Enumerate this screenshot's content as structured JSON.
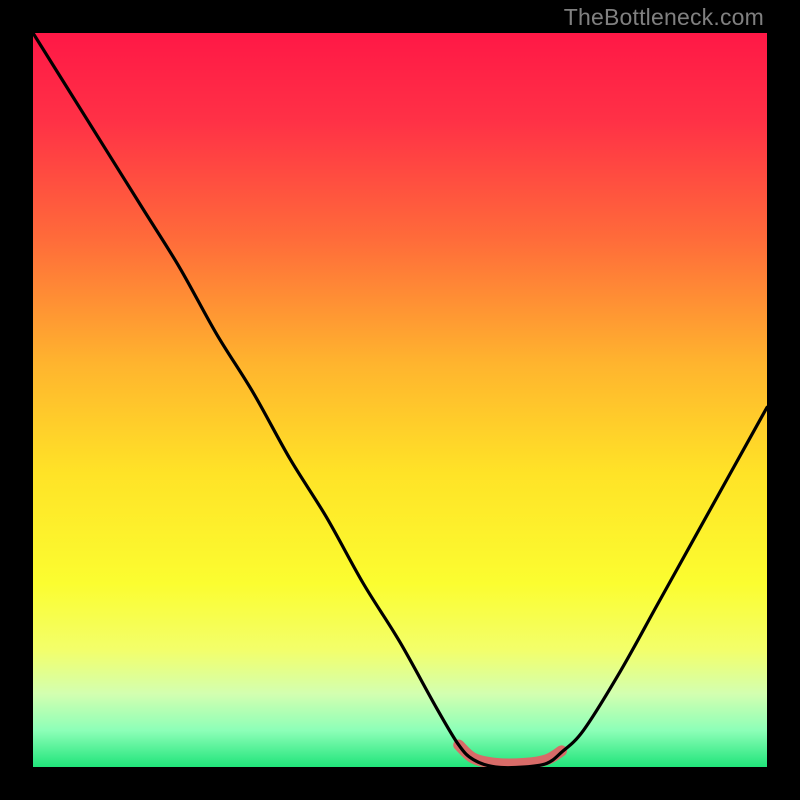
{
  "watermark": "TheBottleneck.com",
  "chart_data": {
    "type": "line",
    "title": "",
    "xlabel": "",
    "ylabel": "",
    "xlim": [
      0,
      100
    ],
    "ylim": [
      0,
      100
    ],
    "series": [
      {
        "name": "bottleneck-curve",
        "x": [
          0,
          5,
          10,
          15,
          20,
          25,
          30,
          35,
          40,
          45,
          50,
          55,
          58,
          60,
          63,
          67,
          70,
          72,
          75,
          80,
          85,
          90,
          95,
          100
        ],
        "values": [
          100,
          92,
          84,
          76,
          68,
          59,
          51,
          42,
          34,
          25,
          17,
          8,
          3,
          1,
          0,
          0,
          0.5,
          2,
          5,
          13,
          22,
          31,
          40,
          49
        ]
      },
      {
        "name": "optimal-band",
        "x": [
          58,
          60,
          63,
          67,
          70,
          72
        ],
        "values": [
          3,
          1.2,
          0.5,
          0.5,
          1,
          2.2
        ]
      }
    ],
    "gradient_stops": [
      {
        "pct": 0,
        "color": "#ff1846"
      },
      {
        "pct": 12,
        "color": "#ff3146"
      },
      {
        "pct": 28,
        "color": "#ff6b3a"
      },
      {
        "pct": 45,
        "color": "#ffb42e"
      },
      {
        "pct": 60,
        "color": "#ffe327"
      },
      {
        "pct": 75,
        "color": "#fbfd30"
      },
      {
        "pct": 84,
        "color": "#f3ff6a"
      },
      {
        "pct": 90,
        "color": "#d3ffb0"
      },
      {
        "pct": 95,
        "color": "#8dffb8"
      },
      {
        "pct": 100,
        "color": "#20e47a"
      }
    ],
    "band_color": "#d86b68"
  }
}
